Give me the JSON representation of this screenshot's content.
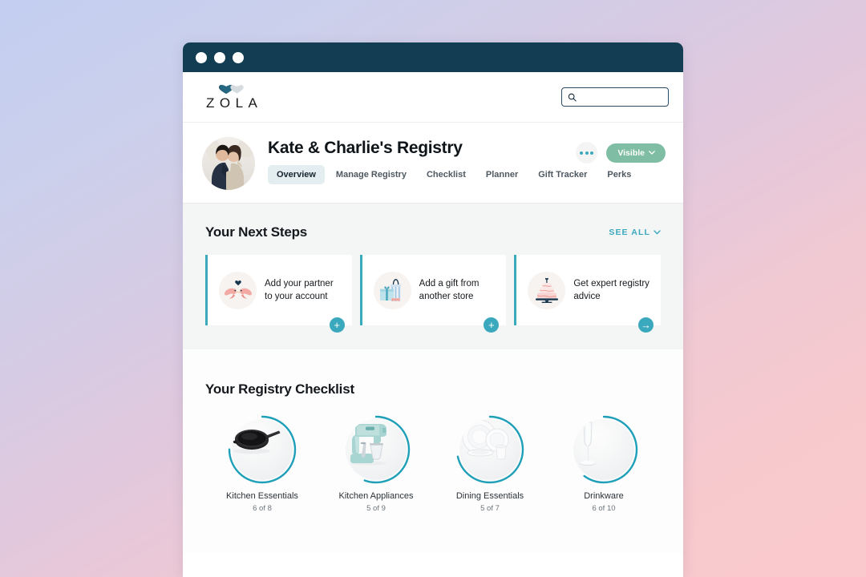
{
  "window": {
    "dots": [
      "close",
      "minimize",
      "maximize"
    ],
    "chrome_color": "#123d52"
  },
  "brand": {
    "logo_text": "ZOLA",
    "heart_dark": "#1d4f66",
    "heart_light": "#d3d9dd"
  },
  "search": {
    "placeholder": "",
    "value": "",
    "icon": "search-icon"
  },
  "registry": {
    "title": "Kate & Charlie's Registry",
    "avatar_alt": "Couple photo",
    "visibility_label": "Visible",
    "visibility_color": "#7fbda4",
    "more_icon": "ellipsis-icon",
    "tabs": [
      {
        "label": "Overview",
        "active": true
      },
      {
        "label": "Manage Registry",
        "active": false
      },
      {
        "label": "Checklist",
        "active": false
      },
      {
        "label": "Planner",
        "active": false
      },
      {
        "label": "Gift Tracker",
        "active": false
      },
      {
        "label": "Perks",
        "active": false
      }
    ]
  },
  "next_steps": {
    "title": "Your Next Steps",
    "see_all_label": "SEE ALL",
    "see_all_icon": "chevron-down-icon",
    "accent_color": "#3aa9bd",
    "cards": [
      {
        "text": "Add your partner to your account",
        "icon": "love-birds-icon",
        "action_icon": "plus-icon",
        "action_symbol": "+"
      },
      {
        "text": "Add a gift from another store",
        "icon": "gift-bag-icon",
        "action_icon": "plus-icon",
        "action_symbol": "+"
      },
      {
        "text": "Get expert registry advice",
        "icon": "wedding-cake-icon",
        "action_icon": "arrow-right-icon",
        "action_symbol": "→"
      }
    ]
  },
  "checklist": {
    "title": "Your Registry Checklist",
    "ring_color": "#1f9fb8",
    "items": [
      {
        "name": "Kitchen Essentials",
        "count_label": "6 of 8",
        "done": 6,
        "total": 8,
        "icon": "skillet-icon"
      },
      {
        "name": "Kitchen Appliances",
        "count_label": "5 of 9",
        "done": 5,
        "total": 9,
        "icon": "stand-mixer-icon"
      },
      {
        "name": "Dining Essentials",
        "count_label": "5 of 7",
        "done": 5,
        "total": 7,
        "icon": "dinner-plates-icon"
      },
      {
        "name": "Drinkware",
        "count_label": "6 of 10",
        "done": 6,
        "total": 10,
        "icon": "champagne-flute-icon"
      }
    ]
  }
}
